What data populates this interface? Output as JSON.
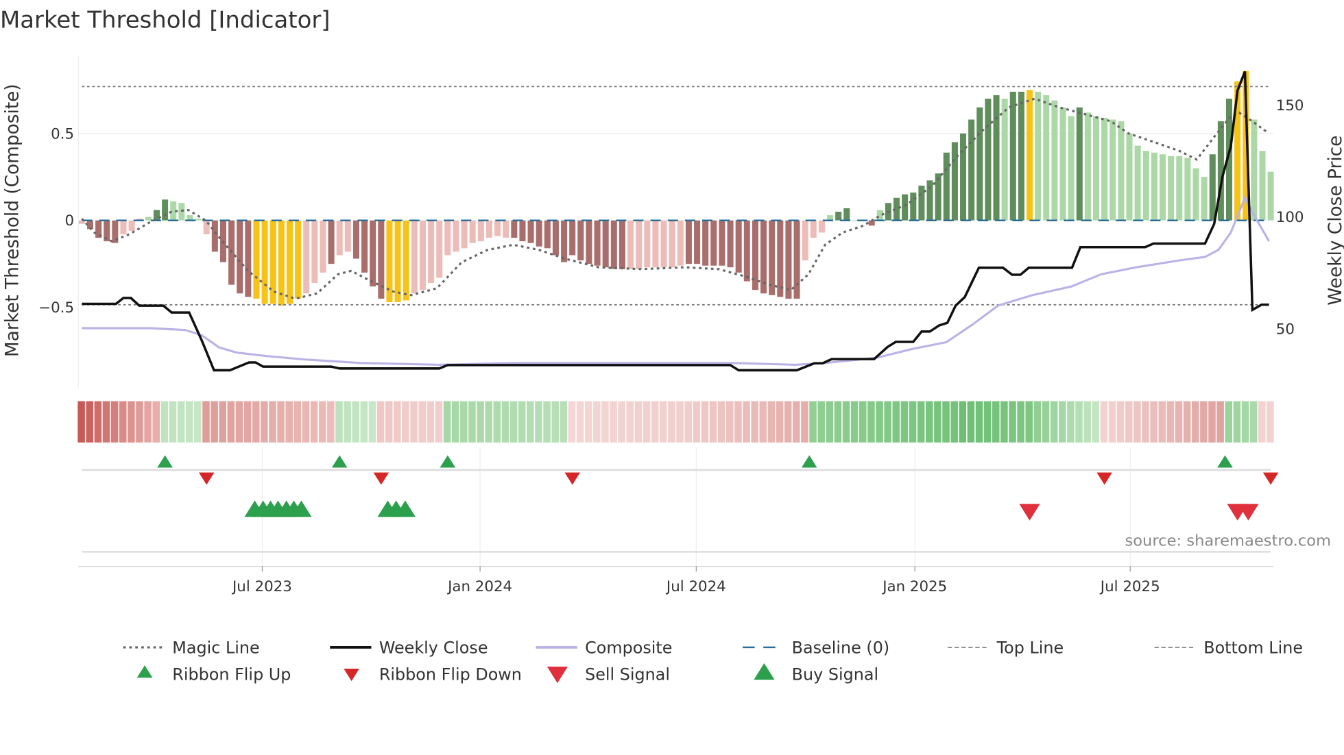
{
  "title": "Market Threshold [Indicator]",
  "source": "source: sharemaestro.com",
  "colors": {
    "D": "#5f8d5b",
    "L": "#acd8a7",
    "R": "#a96e6c",
    "P": "#ecbcb8",
    "Y": "#f7c316",
    "close": "#111111",
    "composite": "#b9b3e6",
    "magic": "#666666",
    "baseline": "#2a6f97",
    "flip_up": "#2ca04c",
    "flip_down": "#d62728",
    "buy": "#2ca04c",
    "sell": "#e0303e"
  },
  "chart_data": {
    "type": "bar+line",
    "title": "Market Threshold [Indicator]",
    "ylabel": "Market Threshold (Composite)",
    "y2label": "Weekly Close Price",
    "ylim": [
      -0.88,
      0.95
    ],
    "y2lim": [
      30,
      170
    ],
    "yticks": [
      {
        "v": 0.5,
        "label": "0.5"
      },
      {
        "v": 0,
        "label": "0"
      },
      {
        "v": -0.5,
        "label": "−0.5"
      }
    ],
    "y2ticks": [
      {
        "v": 150,
        "label": "150"
      },
      {
        "v": 100,
        "label": "100"
      },
      {
        "v": 50,
        "label": "50"
      }
    ],
    "xticks": [
      {
        "w": 21.7,
        "label": "Jul 2023"
      },
      {
        "w": 47.9,
        "label": "Jan 2024"
      },
      {
        "w": 73.9,
        "label": "Jul 2024"
      },
      {
        "w": 100.2,
        "label": "Jan 2025"
      },
      {
        "w": 126.1,
        "label": "Jul 2025"
      }
    ],
    "top_line": 0.77,
    "bottom_line": -0.485,
    "baseline": 0,
    "bars": [
      [
        -0.02,
        "P"
      ],
      [
        -0.05,
        "R"
      ],
      [
        -0.1,
        "R"
      ],
      [
        -0.12,
        "R"
      ],
      [
        -0.13,
        "R"
      ],
      [
        -0.08,
        "P"
      ],
      [
        -0.06,
        "P"
      ],
      [
        0.01,
        "P"
      ],
      [
        0.02,
        "L"
      ],
      [
        0.06,
        "D"
      ],
      [
        0.12,
        "D"
      ],
      [
        0.11,
        "L"
      ],
      [
        0.1,
        "L"
      ],
      [
        0.03,
        "L"
      ],
      [
        0.01,
        "L"
      ],
      [
        -0.08,
        "P"
      ],
      [
        -0.18,
        "R"
      ],
      [
        -0.24,
        "R"
      ],
      [
        -0.37,
        "R"
      ],
      [
        -0.42,
        "R"
      ],
      [
        -0.44,
        "R"
      ],
      [
        -0.45,
        "Y"
      ],
      [
        -0.48,
        "Y"
      ],
      [
        -0.48,
        "Y"
      ],
      [
        -0.49,
        "Y"
      ],
      [
        -0.48,
        "Y"
      ],
      [
        -0.45,
        "Y"
      ],
      [
        -0.42,
        "P"
      ],
      [
        -0.36,
        "P"
      ],
      [
        -0.3,
        "P"
      ],
      [
        -0.25,
        "R"
      ],
      [
        -0.2,
        "P"
      ],
      [
        -0.18,
        "P"
      ],
      [
        -0.22,
        "R"
      ],
      [
        -0.3,
        "R"
      ],
      [
        -0.38,
        "R"
      ],
      [
        -0.45,
        "R"
      ],
      [
        -0.47,
        "Y"
      ],
      [
        -0.47,
        "Y"
      ],
      [
        -0.46,
        "Y"
      ],
      [
        -0.42,
        "P"
      ],
      [
        -0.4,
        "P"
      ],
      [
        -0.36,
        "P"
      ],
      [
        -0.33,
        "P"
      ],
      [
        -0.2,
        "P"
      ],
      [
        -0.18,
        "P"
      ],
      [
        -0.16,
        "P"
      ],
      [
        -0.13,
        "P"
      ],
      [
        -0.12,
        "P"
      ],
      [
        -0.1,
        "P"
      ],
      [
        -0.09,
        "P"
      ],
      [
        -0.1,
        "P"
      ],
      [
        -0.1,
        "R"
      ],
      [
        -0.12,
        "R"
      ],
      [
        -0.13,
        "R"
      ],
      [
        -0.15,
        "R"
      ],
      [
        -0.16,
        "R"
      ],
      [
        -0.2,
        "R"
      ],
      [
        -0.24,
        "R"
      ],
      [
        -0.2,
        "R"
      ],
      [
        -0.23,
        "R"
      ],
      [
        -0.25,
        "R"
      ],
      [
        -0.26,
        "R"
      ],
      [
        -0.27,
        "R"
      ],
      [
        -0.28,
        "R"
      ],
      [
        -0.28,
        "R"
      ],
      [
        -0.28,
        "P"
      ],
      [
        -0.28,
        "P"
      ],
      [
        -0.27,
        "P"
      ],
      [
        -0.27,
        "P"
      ],
      [
        -0.27,
        "P"
      ],
      [
        -0.27,
        "P"
      ],
      [
        -0.26,
        "P"
      ],
      [
        -0.25,
        "R"
      ],
      [
        -0.25,
        "R"
      ],
      [
        -0.26,
        "R"
      ],
      [
        -0.26,
        "R"
      ],
      [
        -0.26,
        "R"
      ],
      [
        -0.27,
        "R"
      ],
      [
        -0.3,
        "R"
      ],
      [
        -0.35,
        "R"
      ],
      [
        -0.4,
        "R"
      ],
      [
        -0.42,
        "R"
      ],
      [
        -0.43,
        "R"
      ],
      [
        -0.44,
        "R"
      ],
      [
        -0.45,
        "R"
      ],
      [
        -0.45,
        "R"
      ],
      [
        -0.23,
        "P"
      ],
      [
        -0.1,
        "P"
      ],
      [
        -0.07,
        "P"
      ],
      [
        0.03,
        "L"
      ],
      [
        0.05,
        "D"
      ],
      [
        0.07,
        "D"
      ],
      [
        0.0,
        "L"
      ],
      [
        0.0,
        "L"
      ],
      [
        -0.03,
        "R"
      ],
      [
        0.06,
        "L"
      ],
      [
        0.1,
        "D"
      ],
      [
        0.13,
        "D"
      ],
      [
        0.15,
        "D"
      ],
      [
        0.16,
        "D"
      ],
      [
        0.2,
        "D"
      ],
      [
        0.23,
        "D"
      ],
      [
        0.27,
        "D"
      ],
      [
        0.39,
        "D"
      ],
      [
        0.45,
        "D"
      ],
      [
        0.5,
        "D"
      ],
      [
        0.58,
        "D"
      ],
      [
        0.65,
        "D"
      ],
      [
        0.7,
        "D"
      ],
      [
        0.72,
        "D"
      ],
      [
        0.7,
        "L"
      ],
      [
        0.74,
        "D"
      ],
      [
        0.74,
        "D"
      ],
      [
        0.75,
        "Y"
      ],
      [
        0.74,
        "L"
      ],
      [
        0.72,
        "L"
      ],
      [
        0.69,
        "L"
      ],
      [
        0.65,
        "L"
      ],
      [
        0.6,
        "L"
      ],
      [
        0.65,
        "D"
      ],
      [
        0.62,
        "L"
      ],
      [
        0.6,
        "L"
      ],
      [
        0.59,
        "L"
      ],
      [
        0.58,
        "L"
      ],
      [
        0.57,
        "L"
      ],
      [
        0.5,
        "L"
      ],
      [
        0.43,
        "L"
      ],
      [
        0.4,
        "L"
      ],
      [
        0.39,
        "L"
      ],
      [
        0.38,
        "L"
      ],
      [
        0.37,
        "L"
      ],
      [
        0.37,
        "L"
      ],
      [
        0.36,
        "L"
      ],
      [
        0.3,
        "L"
      ],
      [
        0.25,
        "L"
      ],
      [
        0.38,
        "D"
      ],
      [
        0.57,
        "D"
      ],
      [
        0.7,
        "D"
      ],
      [
        0.8,
        "Y"
      ],
      [
        0.86,
        "Y"
      ],
      [
        0.58,
        "L"
      ],
      [
        0.4,
        "L"
      ],
      [
        0.28,
        "L"
      ]
    ],
    "magic_line": [
      [
        0,
        0.01
      ],
      [
        1.5,
        -0.07
      ],
      [
        3.6,
        -0.12
      ],
      [
        5.7,
        -0.08
      ],
      [
        8.2,
        -0.01
      ],
      [
        10.8,
        0.05
      ],
      [
        12.8,
        0.06
      ],
      [
        14.9,
        0.0
      ],
      [
        16.9,
        -0.12
      ],
      [
        20.0,
        -0.29
      ],
      [
        23.1,
        -0.41
      ],
      [
        25.7,
        -0.45
      ],
      [
        28.3,
        -0.42
      ],
      [
        30.8,
        -0.31
      ],
      [
        32.4,
        -0.29
      ],
      [
        34.4,
        -0.34
      ],
      [
        37.5,
        -0.41
      ],
      [
        39.6,
        -0.43
      ],
      [
        42.7,
        -0.39
      ],
      [
        45.7,
        -0.24
      ],
      [
        48.8,
        -0.17
      ],
      [
        51.9,
        -0.14
      ],
      [
        55.0,
        -0.17
      ],
      [
        58.1,
        -0.22
      ],
      [
        62.2,
        -0.27
      ],
      [
        67.3,
        -0.28
      ],
      [
        72.5,
        -0.27
      ],
      [
        76.6,
        -0.28
      ],
      [
        79.6,
        -0.32
      ],
      [
        82.7,
        -0.37
      ],
      [
        85.3,
        -0.4
      ],
      [
        87.4,
        -0.31
      ],
      [
        89.4,
        -0.14
      ],
      [
        91.5,
        -0.07
      ],
      [
        94.0,
        -0.03
      ],
      [
        96.1,
        0.03
      ],
      [
        99.2,
        0.09
      ],
      [
        102.3,
        0.2
      ],
      [
        105.3,
        0.37
      ],
      [
        108.4,
        0.52
      ],
      [
        111.5,
        0.65
      ],
      [
        114.6,
        0.7
      ],
      [
        117.6,
        0.65
      ],
      [
        120.7,
        0.61
      ],
      [
        123.8,
        0.57
      ],
      [
        125.9,
        0.5
      ],
      [
        129.0,
        0.45
      ],
      [
        132.0,
        0.4
      ],
      [
        134.1,
        0.35
      ],
      [
        136.2,
        0.48
      ],
      [
        138.2,
        0.6
      ],
      [
        139.2,
        0.62
      ],
      [
        140.8,
        0.57
      ],
      [
        142.5,
        0.51
      ]
    ],
    "weekly_close": [
      [
        0,
        61.2
      ],
      [
        4.1,
        61.2
      ],
      [
        5,
        63.8
      ],
      [
        5.9,
        63.8
      ],
      [
        6.9,
        60.4
      ],
      [
        9.8,
        60.4
      ],
      [
        10.8,
        57.3
      ],
      [
        12.9,
        57.3
      ],
      [
        14.4,
        45.0
      ],
      [
        15.9,
        31.5
      ],
      [
        17.8,
        31.5
      ],
      [
        20.1,
        35.0
      ],
      [
        20.9,
        35.0
      ],
      [
        21.8,
        33.1
      ],
      [
        30,
        33.1
      ],
      [
        31,
        32.3
      ],
      [
        43,
        32.3
      ],
      [
        44,
        33.8
      ],
      [
        78,
        33.8
      ],
      [
        79,
        31.5
      ],
      [
        86,
        31.5
      ],
      [
        88.1,
        34.6
      ],
      [
        89.1,
        34.6
      ],
      [
        90.2,
        36.5
      ],
      [
        95.3,
        36.5
      ],
      [
        96.9,
        41.9
      ],
      [
        97.9,
        44.2
      ],
      [
        100,
        44.2
      ],
      [
        101,
        48.8
      ],
      [
        102,
        48.8
      ],
      [
        103.1,
        51.5
      ],
      [
        104.1,
        52.7
      ],
      [
        105.1,
        60.4
      ],
      [
        106.2,
        64.2
      ],
      [
        107.9,
        77.3
      ],
      [
        110.8,
        77.3
      ],
      [
        111.9,
        74.2
      ],
      [
        112.9,
        74.2
      ],
      [
        113.9,
        77.3
      ],
      [
        119.1,
        77.3
      ],
      [
        120.1,
        86.5
      ],
      [
        127.9,
        86.5
      ],
      [
        128.9,
        88.1
      ],
      [
        135.1,
        88.1
      ],
      [
        136.2,
        96.9
      ],
      [
        137.2,
        118.1
      ],
      [
        138.2,
        131.5
      ],
      [
        139,
        156.5
      ],
      [
        139.9,
        165.0
      ],
      [
        140.8,
        58.5
      ],
      [
        141.9,
        60.8
      ],
      [
        142.8,
        60.8
      ]
    ],
    "composite_line": [
      [
        0,
        -0.62
      ],
      [
        8.2,
        -0.62
      ],
      [
        12.4,
        -0.63
      ],
      [
        14.4,
        -0.66
      ],
      [
        16.5,
        -0.73
      ],
      [
        18.6,
        -0.76
      ],
      [
        22.2,
        -0.78
      ],
      [
        26.8,
        -0.8
      ],
      [
        33.5,
        -0.82
      ],
      [
        42.8,
        -0.83
      ],
      [
        52.1,
        -0.82
      ],
      [
        78,
        -0.82
      ],
      [
        85.8,
        -0.83
      ],
      [
        89.4,
        -0.82
      ],
      [
        95.6,
        -0.79
      ],
      [
        99.8,
        -0.74
      ],
      [
        104.0,
        -0.7
      ],
      [
        107.1,
        -0.6
      ],
      [
        110.2,
        -0.49
      ],
      [
        114.3,
        -0.43
      ],
      [
        119,
        -0.38
      ],
      [
        122.6,
        -0.31
      ],
      [
        126.8,
        -0.27
      ],
      [
        132,
        -0.23
      ],
      [
        135.1,
        -0.21
      ],
      [
        136.7,
        -0.17
      ],
      [
        138.2,
        -0.07
      ],
      [
        139.9,
        0.13
      ],
      [
        141.3,
        0.005
      ],
      [
        142.8,
        -0.12
      ]
    ],
    "ribbon": [
      [
        0,
        9,
        "#c65a57",
        "#e8aeab"
      ],
      [
        10,
        14,
        "#bfe2bf",
        "#c6e6c6"
      ],
      [
        15,
        30,
        "#dd9d99",
        "#ebbcb9"
      ],
      [
        31,
        35,
        "#bde1bd",
        "#c8e7c8"
      ],
      [
        36,
        43,
        "#efc8c6",
        "#f0cecc"
      ],
      [
        44,
        58,
        "#a6d7a6",
        "#b9dfb9"
      ],
      [
        59,
        73,
        "#f3d6d5",
        "#f0cecc"
      ],
      [
        74,
        87,
        "#efcac8",
        "#e4aeab"
      ],
      [
        88,
        105,
        "#91cf93",
        "#74c27a"
      ],
      [
        106,
        114,
        "#6dbf74",
        "#7ec783"
      ],
      [
        115,
        122,
        "#90ce92",
        "#c2e5c2"
      ],
      [
        123,
        137,
        "#f2d3d2",
        "#dfa3a0"
      ],
      [
        138,
        141,
        "#9bd39d",
        "#a9d9aa"
      ],
      [
        142,
        143,
        "#f2d3d2",
        "#f2d3d2"
      ]
    ],
    "ribbon_flip_up": [
      10,
      31,
      44,
      87.5,
      137.5
    ],
    "ribbon_flip_down": [
      15,
      36,
      59,
      123,
      143
    ],
    "buy_signals": [
      20.8,
      21.8,
      22.7,
      23.6,
      24.6,
      25.5,
      26.4,
      36.8,
      37.8,
      38.9
    ],
    "sell_signals": [
      114,
      139,
      140.3
    ],
    "legend": [
      {
        "label": "Magic Line",
        "kind": "dotted"
      },
      {
        "label": "Weekly Close",
        "kind": "close"
      },
      {
        "label": "Composite",
        "kind": "composite"
      },
      {
        "label": "Baseline (0)",
        "kind": "baseline"
      },
      {
        "label": "Top Line",
        "kind": "dashed"
      },
      {
        "label": "Bottom Line",
        "kind": "dashed"
      },
      {
        "label": "Ribbon Flip Up",
        "kind": "flip_up"
      },
      {
        "label": "Ribbon Flip Down",
        "kind": "flip_down"
      },
      {
        "label": "Sell Signal",
        "kind": "sell"
      },
      {
        "label": "Buy Signal",
        "kind": "buy"
      }
    ]
  }
}
